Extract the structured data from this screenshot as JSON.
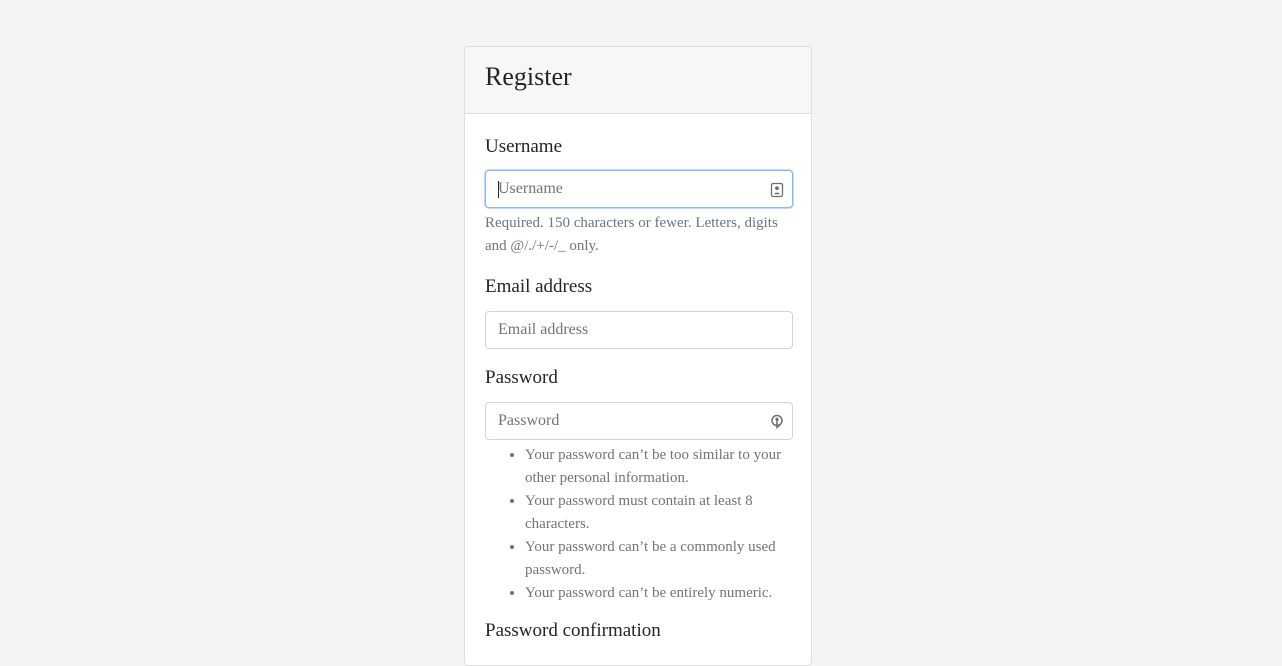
{
  "form": {
    "title": "Register",
    "username": {
      "label": "Username",
      "placeholder": "Username",
      "value": "",
      "help": "Required. 150 characters or fewer. Letters, digits and @/./+/-/_ only."
    },
    "email": {
      "label": "Email address",
      "placeholder": "Email address",
      "value": ""
    },
    "password": {
      "label": "Password",
      "placeholder": "Password",
      "value": "",
      "rules": [
        "Your password can’t be too similar to your other personal information.",
        "Your password must contain at least 8 characters.",
        "Your password can’t be a commonly used password.",
        "Your password can’t be entirely numeric."
      ]
    },
    "password_confirmation": {
      "label": "Password confirmation"
    }
  },
  "icons": {
    "username_field": "contact-card-icon",
    "password_field": "key-icon"
  },
  "colors": {
    "page_background": "#f4f4f4",
    "focus_border": "#86b7fe",
    "help_text": "#6c757d"
  }
}
